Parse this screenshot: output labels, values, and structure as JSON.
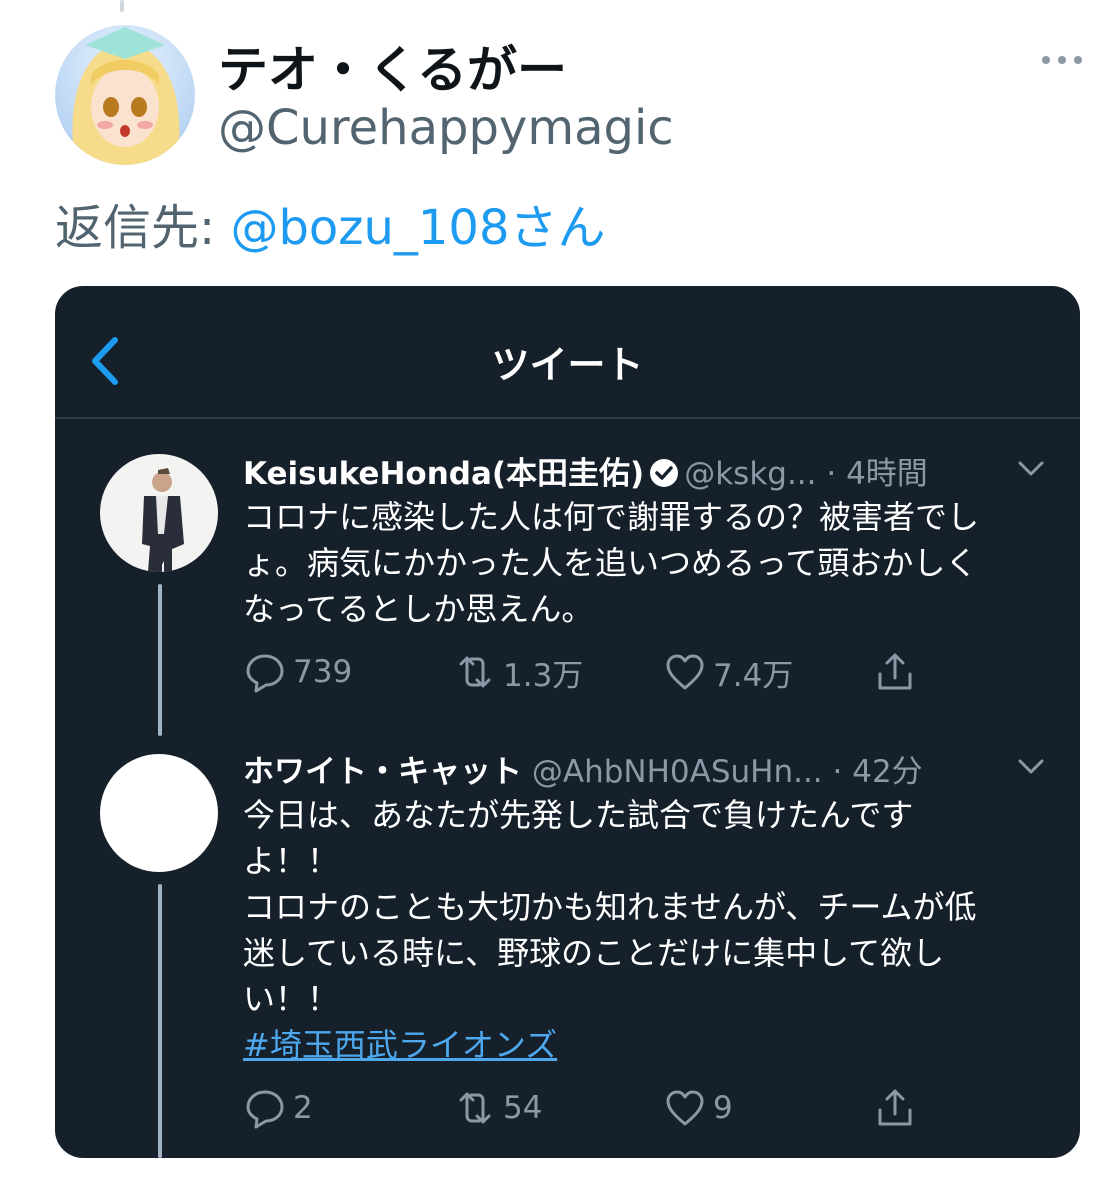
{
  "outer_tweet": {
    "display_name": "テオ・くるがー",
    "handle": "@Curehappymagic",
    "reply_prefix": "返信先: ",
    "reply_to": "@bozu_108さん"
  },
  "screenshot": {
    "header_title": "ツイート",
    "tweets": [
      {
        "display_name": "KeisukeHonda(本田圭佑)",
        "handle": "@kskg...",
        "time": "· 4時間",
        "verified": true,
        "body_lines": [
          "コロナに感染した人は何で謝罪するの？被害者でし",
          "ょ。病気にかかった人を追いつめるって頭おかしく",
          "なってるとしか思えん。"
        ],
        "replies": "739",
        "retweets": "1.3万",
        "likes": "7.4万"
      },
      {
        "display_name": "ホワイト・キャット",
        "handle": "@AhbNH0ASuHn...",
        "time": "· 42分",
        "verified": false,
        "body_lines": [
          "今日は、あなたが先発した試合で負けたんです",
          "よ！！",
          "コロナのことも大切かも知れませんが、チームが低",
          "迷している時に、野球のことだけに集中して欲し",
          "い！！"
        ],
        "hashtag": "#埼玉西武ライオンズ",
        "replies": "2",
        "retweets": "54",
        "likes": "9"
      }
    ]
  },
  "icons": {
    "more": "more-horizontal-icon",
    "back": "chevron-left-icon",
    "verified": "verified-badge-icon",
    "caret": "chevron-down-icon",
    "reply": "reply-icon",
    "retweet": "retweet-icon",
    "like": "heart-icon",
    "share": "share-icon"
  },
  "colors": {
    "link_blue": "#1d9bf0",
    "card_bg": "#15202b",
    "muted_text": "#8b98a5"
  }
}
